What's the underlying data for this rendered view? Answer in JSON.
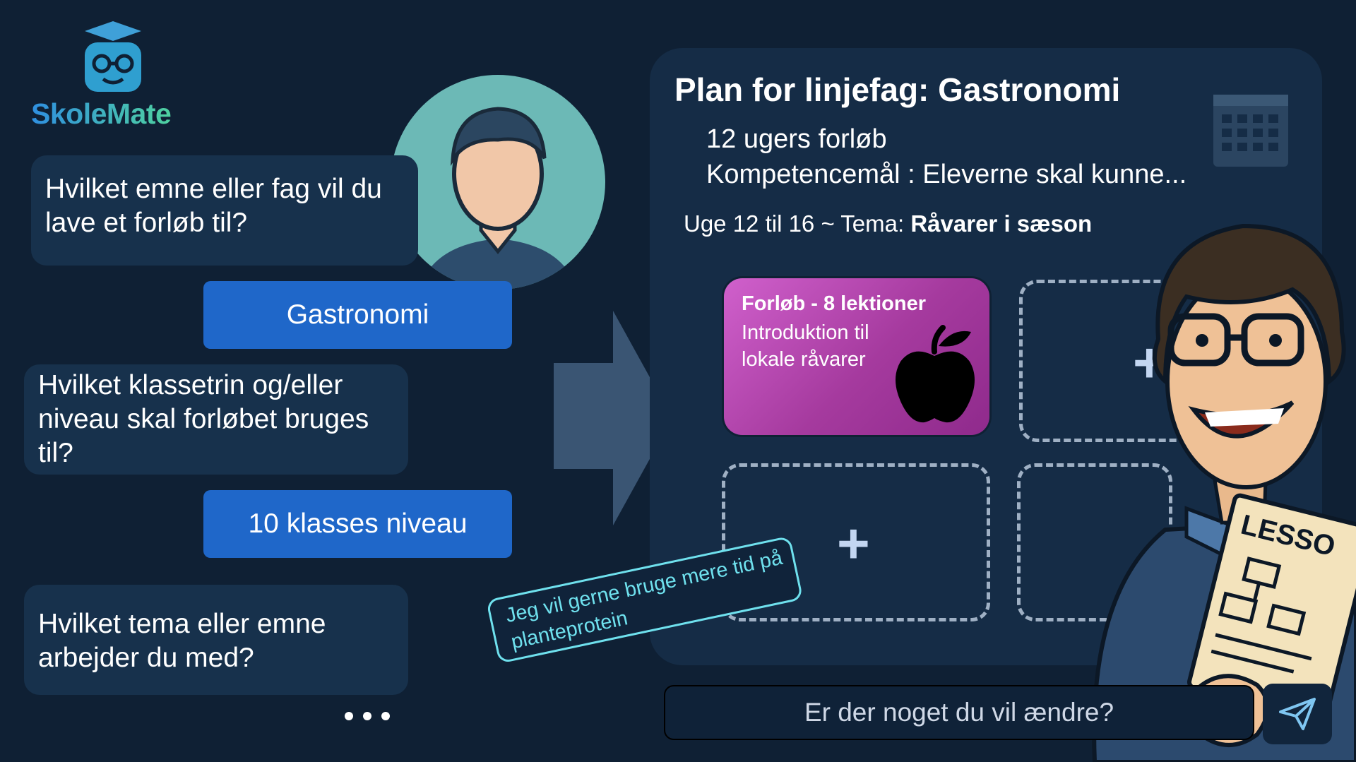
{
  "brand": {
    "name": "SkoleMate"
  },
  "chat": {
    "messages": [
      {
        "role": "assistant",
        "text": "Hvilket emne eller fag vil du lave et forløb til?"
      },
      {
        "role": "user",
        "text": "Gastronomi"
      },
      {
        "role": "assistant",
        "text": "Hvilket klassetrin og/eller niveau skal forløbet bruges til?"
      },
      {
        "role": "user",
        "text": "10 klasses niveau"
      },
      {
        "role": "assistant",
        "text": "Hvilket tema eller emne arbejder du med?"
      }
    ],
    "more_indicator": "•••"
  },
  "plan": {
    "title": "Plan for linjefag: Gastronomi",
    "duration": "12 ugers forløb",
    "competence": "Kompetencemål : Eleverne skal kunne...",
    "week_prefix": "Uge 12 til 16 ~ Tema: ",
    "week_theme": "Råvarer i sæson",
    "card": {
      "title": "Forløb - 8 lektioner",
      "text": "Introduktion til lokale råvarer",
      "icon": "apple-icon",
      "color": "#b84bb4"
    },
    "add_slot_label": "+"
  },
  "note": {
    "text": "Jeg vil gerne bruge mere tid på planteprotein"
  },
  "input": {
    "placeholder": "Er der noget du vil ændre?"
  },
  "illustration": {
    "lesson_paper_label": "LESSO"
  },
  "colors": {
    "background": "#0f2034",
    "bubble": "#17314c",
    "answer": "#1f67c9",
    "note": "#6fe1ee"
  }
}
